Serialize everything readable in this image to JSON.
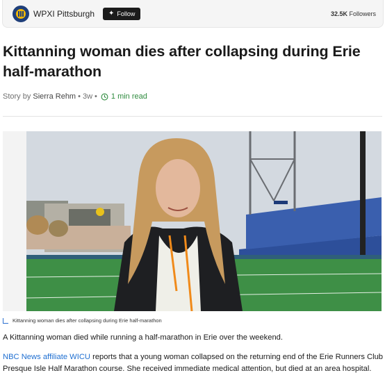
{
  "publisher": {
    "name": "WPXI Pittsburgh",
    "follow_label": "Follow",
    "followers_count": "32.5K",
    "followers_label": "Followers"
  },
  "article": {
    "title": "Kittanning woman dies after collapsing during Erie half-marathon",
    "byline_prefix": "Story by",
    "author": "Sierra Rehm",
    "age": "3w",
    "read_time": "1 min read",
    "image_caption": "Kittanning woman dies after collapsing during Erie half-marathon",
    "paragraph1": "A Kittanning woman died while running a half-marathon in Erie over the weekend.",
    "paragraph2_link1": "NBC News",
    "paragraph2_link2": "affiliate WICU",
    "paragraph2_rest": " reports that a young woman collapsed on the returning end of the Erie Runners Club Presque Isle Half Marathon course. She received immediate medical attention, but died at an area hospital."
  },
  "colors": {
    "link": "#1f6fd1",
    "read_time": "#2e8b3e",
    "follow_bg": "#1c1c1c"
  },
  "icons": [
    "wpxi-logo-icon",
    "plus-icon",
    "clock-icon",
    "caption-corner-icon"
  ]
}
